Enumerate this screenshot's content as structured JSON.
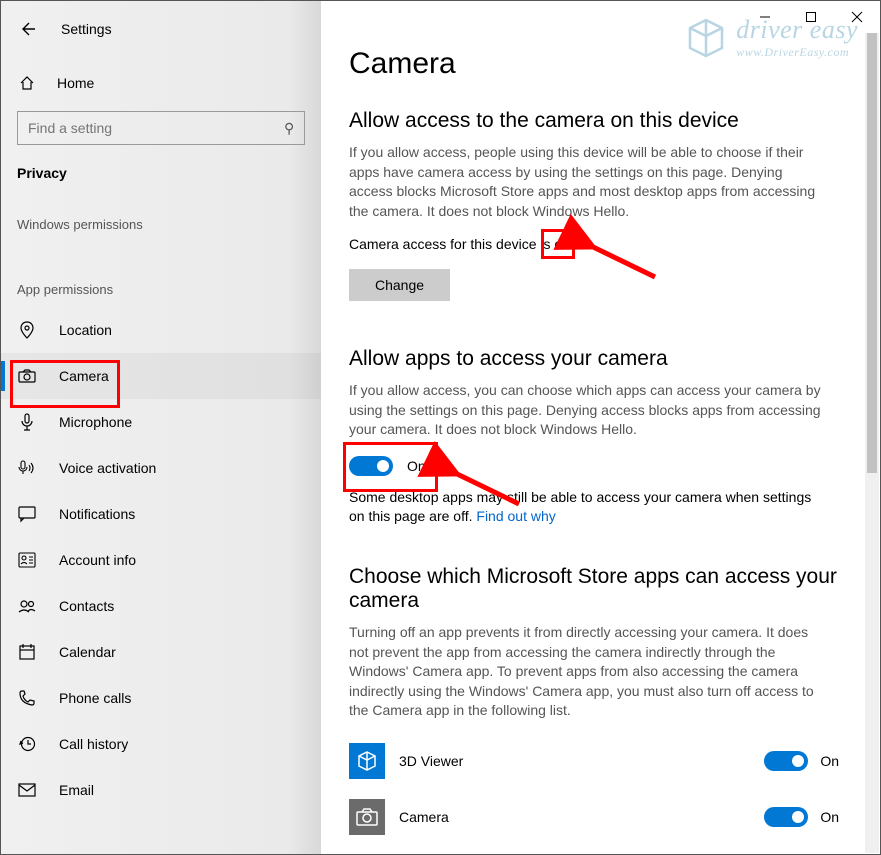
{
  "window": {
    "app_title": "Settings"
  },
  "sidebar": {
    "home_label": "Home",
    "search_placeholder": "Find a setting",
    "category": "Privacy",
    "section_windows": "Windows permissions",
    "section_app": "App permissions",
    "items": [
      {
        "label": "Location"
      },
      {
        "label": "Camera"
      },
      {
        "label": "Microphone"
      },
      {
        "label": "Voice activation"
      },
      {
        "label": "Notifications"
      },
      {
        "label": "Account info"
      },
      {
        "label": "Contacts"
      },
      {
        "label": "Calendar"
      },
      {
        "label": "Phone calls"
      },
      {
        "label": "Call history"
      },
      {
        "label": "Email"
      }
    ]
  },
  "main": {
    "title": "Camera",
    "section1": {
      "heading": "Allow access to the camera on this device",
      "body": "If you allow access, people using this device will be able to choose if their apps have camera access by using the settings on this page. Denying access blocks Microsoft Store apps and most desktop apps from accessing the camera. It does not block Windows Hello.",
      "status_prefix": "Camera access for this device is ",
      "status_value": "on",
      "change_button": "Change"
    },
    "section2": {
      "heading": "Allow apps to access your camera",
      "body": "If you allow access, you can choose which apps can access your camera by using the settings on this page. Denying access blocks apps from accessing your camera. It does not block Windows Hello.",
      "toggle_label": "On",
      "note_prefix": "Some desktop apps may still be able to access your camera when settings on this page are off. ",
      "note_link": "Find out why"
    },
    "section3": {
      "heading": "Choose which Microsoft Store apps can access your camera",
      "body": "Turning off an app prevents it from directly accessing your camera. It does not prevent the app from accessing the camera indirectly through the Windows' Camera app. To prevent apps from also accessing the camera indirectly using the Windows' Camera app, you must also turn off access to the Camera app in the following list.",
      "apps": [
        {
          "name": "3D Viewer",
          "state": "On"
        },
        {
          "name": "Camera",
          "state": "On"
        }
      ]
    }
  },
  "watermark": {
    "line1": "driver easy",
    "line2": "www.DriverEasy.com"
  }
}
